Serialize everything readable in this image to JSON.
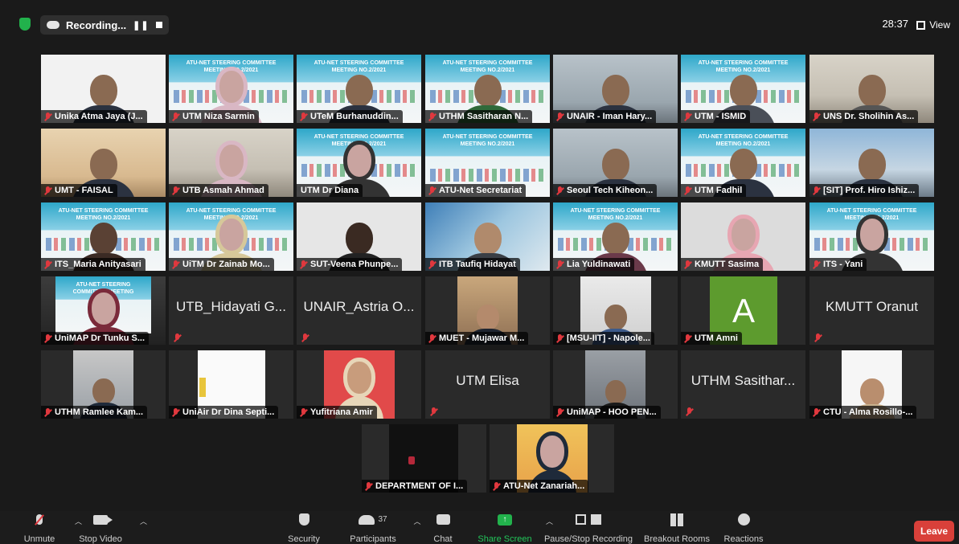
{
  "top": {
    "recording_label": "Recording...",
    "timer": "28:37",
    "view_label": "View"
  },
  "tiles": [
    {
      "name": "Unika Atma Jaya (J...",
      "muted": true
    },
    {
      "name": "UTM Niza Sarmin",
      "muted": true
    },
    {
      "name": "UTeM Burhanuddin...",
      "muted": true
    },
    {
      "name": "UTHM Sasitharan N...",
      "muted": true
    },
    {
      "name": "UNAIR - Iman Hary...",
      "muted": true
    },
    {
      "name": "UTM - ISMID",
      "muted": true
    },
    {
      "name": "UNS Dr. Sholihin As...",
      "muted": true
    },
    {
      "name": "UMT - FAISAL",
      "muted": true
    },
    {
      "name": "UTB Asmah Ahmad",
      "muted": true
    },
    {
      "name": "UTM Dr Diana",
      "muted": false,
      "speaking": true
    },
    {
      "name": "ATU-Net Secretariat",
      "muted": true
    },
    {
      "name": "Seoul Tech Kiheon...",
      "muted": true
    },
    {
      "name": "UTM Fadhil",
      "muted": true
    },
    {
      "name": "[SIT] Prof. Hiro Ishiz...",
      "muted": true
    },
    {
      "name": "ITS_Maria Anityasari",
      "muted": true
    },
    {
      "name": "UiTM Dr Zainab Mo...",
      "muted": true
    },
    {
      "name": "SUT-Veena Phunpe...",
      "muted": true
    },
    {
      "name": "ITB Taufiq Hidayat",
      "muted": true
    },
    {
      "name": "Lia Yuldinawati",
      "muted": true
    },
    {
      "name": "KMUTT Sasima",
      "muted": true
    },
    {
      "name": "ITS - Yani",
      "muted": true
    },
    {
      "name": "UniMAP Dr Tunku S...",
      "muted": true
    },
    {
      "name": "UTB_Hidayati G...",
      "muted": true
    },
    {
      "name": "UNAIR_Astria O...",
      "muted": true
    },
    {
      "name": "MUET - Mujawar M...",
      "muted": true
    },
    {
      "name": "[MSU-IIT] - Napole...",
      "muted": true
    },
    {
      "name": "UTM Amni",
      "muted": true,
      "avatar_letter": "A"
    },
    {
      "name": "KMUTT Oranut",
      "muted": true
    },
    {
      "name": "UTHM Ramlee Kam...",
      "muted": true
    },
    {
      "name": "UniAir Dr Dina Septi...",
      "muted": true
    },
    {
      "name": "Yufitriana Amir",
      "muted": true
    },
    {
      "name": "UTM Elisa",
      "muted": true
    },
    {
      "name": "UniMAP - HOO PEN...",
      "muted": true
    },
    {
      "name": "UTHM Sasithar...",
      "muted": true
    },
    {
      "name": "CTU - Alma Rosillo-...",
      "muted": true
    },
    {
      "name": "DEPARTMENT OF I...",
      "muted": true
    },
    {
      "name": "ATU-Net Zanariah...",
      "muted": true
    }
  ],
  "slide_title": "ATU-NET STEERING COMMITTEE MEETING NO.2/2021",
  "slide_title_short": "ATU-NET STEERING COMMITTEE MEETING NO.2/2021",
  "toolbar": {
    "unmute": "Unmute",
    "stop_video": "Stop Video",
    "security": "Security",
    "participants": "Participants",
    "participant_count": "37",
    "chat": "Chat",
    "share_screen": "Share Screen",
    "pause_recording": "Pause/Stop Recording",
    "breakout": "Breakout Rooms",
    "reactions": "Reactions",
    "leave": "Leave"
  },
  "colors": {
    "background": "#1a1a1a",
    "active_speaker": "#d7e54a",
    "muted_mic": "#e0383e",
    "share_green": "#22b24c",
    "leave_red": "#d9403a",
    "avatar_green": "#5d9b2e"
  }
}
